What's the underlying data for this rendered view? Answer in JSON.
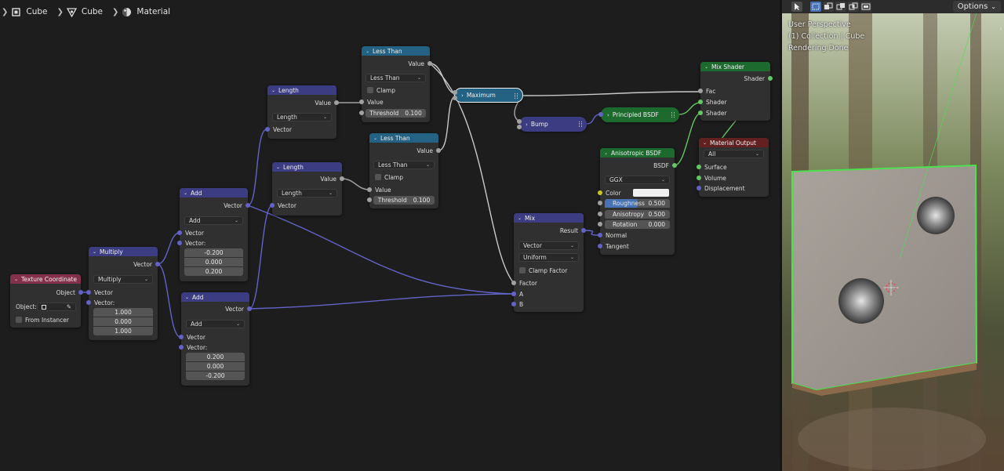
{
  "breadcrumb": {
    "object": "Cube",
    "mesh": "Cube",
    "material": "Material"
  },
  "nodes": {
    "texcoord": {
      "title": "Texture Coordinate",
      "object_out": "Object",
      "object_field_label": "Object:",
      "from_instancer": "From Instancer"
    },
    "multiply": {
      "title": "Multiply",
      "vector_out": "Vector",
      "op": "Multiply",
      "vector_in": "Vector",
      "vector2_label": "Vector:",
      "v": [
        "1.000",
        "0.000",
        "1.000"
      ]
    },
    "add1": {
      "title": "Add",
      "vector_out": "Vector",
      "op": "Add",
      "vector_in": "Vector",
      "vector2_label": "Vector:",
      "v": [
        "-0.200",
        "0.000",
        "0.200"
      ]
    },
    "add2": {
      "title": "Add",
      "vector_out": "Vector",
      "op": "Add",
      "vector_in": "Vector",
      "vector2_label": "Vector:",
      "v": [
        "0.200",
        "0.000",
        "-0.200"
      ]
    },
    "length1": {
      "title": "Length",
      "value_out": "Value",
      "op": "Length",
      "vector_in": "Vector"
    },
    "length2": {
      "title": "Length",
      "value_out": "Value",
      "op": "Length",
      "vector_in": "Vector"
    },
    "lt1": {
      "title": "Less Than",
      "value_out": "Value",
      "op": "Less Than",
      "clamp": "Clamp",
      "value_in": "Value",
      "threshold_label": "Threshold",
      "threshold": "0.100"
    },
    "lt2": {
      "title": "Less Than",
      "value_out": "Value",
      "op": "Less Than",
      "clamp": "Clamp",
      "value_in": "Value",
      "threshold_label": "Threshold",
      "threshold": "0.100"
    },
    "maximum": {
      "title": "Maximum"
    },
    "bump": {
      "title": "Bump"
    },
    "principled": {
      "title": "Principled BSDF"
    },
    "mix": {
      "title": "Mix",
      "result": "Result",
      "type": "Vector",
      "mode": "Uniform",
      "clamp": "Clamp Factor",
      "factor": "Factor",
      "a": "A",
      "b": "B"
    },
    "aniso": {
      "title": "Anisotropic BSDF",
      "bsdf": "BSDF",
      "dist": "GGX",
      "color": "Color",
      "roughness_label": "Roughness",
      "roughness": "0.500",
      "anisotropy_label": "Anisotropy",
      "anisotropy": "0.500",
      "rotation_label": "Rotation",
      "rotation": "0.000",
      "normal": "Normal",
      "tangent": "Tangent"
    },
    "mixshader": {
      "title": "Mix Shader",
      "shader_out": "Shader",
      "fac": "Fac",
      "shader1": "Shader",
      "shader2": "Shader"
    },
    "matout": {
      "title": "Material Output",
      "target": "All",
      "surface": "Surface",
      "volume": "Volume",
      "displacement": "Displacement"
    }
  },
  "viewport": {
    "line1": "User Perspective",
    "line2": "(1) Collection | Cube",
    "line3": "Rendering Done",
    "options": "Options"
  },
  "colors": {
    "vector_header": "#3c3c83",
    "converter_header": "#246283",
    "input_header": "#83314a",
    "shader_header": "#1c6a2e",
    "output_header": "#632020",
    "selection_outline": "#4ee04e"
  }
}
